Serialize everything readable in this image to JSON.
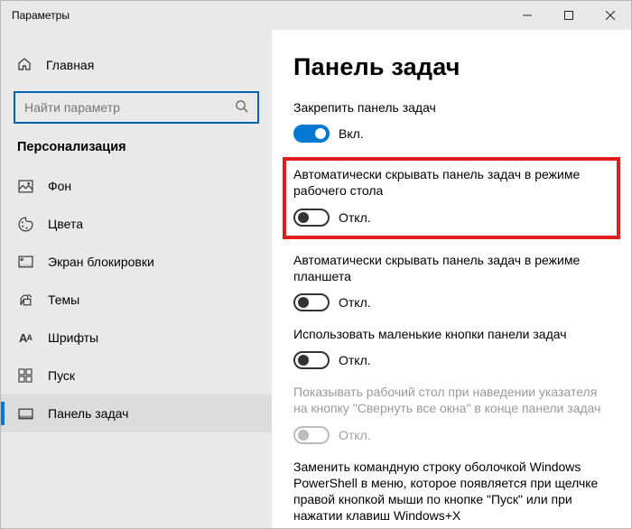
{
  "window": {
    "title": "Параметры"
  },
  "sidebar": {
    "home": "Главная",
    "search_placeholder": "Найти параметр",
    "category": "Персонализация",
    "items": [
      {
        "label": "Фон"
      },
      {
        "label": "Цвета"
      },
      {
        "label": "Экран блокировки"
      },
      {
        "label": "Темы"
      },
      {
        "label": "Шрифты"
      },
      {
        "label": "Пуск"
      },
      {
        "label": "Панель задач"
      }
    ]
  },
  "page": {
    "title": "Панель задач",
    "settings": [
      {
        "label": "Закрепить панель задач",
        "state": "Вкл.",
        "on": true
      },
      {
        "label": "Автоматически скрывать панель задач в режиме рабочего стола",
        "state": "Откл.",
        "on": false,
        "highlight": true
      },
      {
        "label": "Автоматически скрывать панель задач в режиме планшета",
        "state": "Откл.",
        "on": false
      },
      {
        "label": "Использовать маленькие кнопки панели задач",
        "state": "Откл.",
        "on": false
      },
      {
        "label": "Показывать рабочий стол при наведении указателя на кнопку \"Свернуть все окна\" в конце панели задач",
        "state": "Откл.",
        "on": false,
        "disabled": true
      },
      {
        "label": "Заменить командную строку оболочкой Windows PowerShell в меню, которое появляется при щелчке правой кнопкой мыши по кнопке \"Пуск\" или при нажатии клавиш Windows+X",
        "state": "",
        "on": false
      }
    ]
  }
}
